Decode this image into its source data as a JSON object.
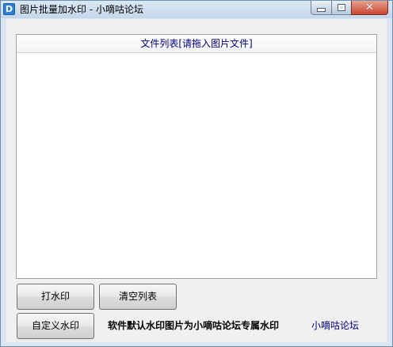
{
  "window": {
    "icon_letter": "D",
    "title": "图片批量加水印 - 小嘀咕论坛",
    "controls": {
      "minimize": "minimize",
      "maximize": "maximize",
      "close": "close"
    }
  },
  "file_list": {
    "header": "文件列表[请拖入图片文件]",
    "items": []
  },
  "buttons": {
    "add_watermark": "打水印",
    "clear_list": "清空列表",
    "custom_watermark": "自定义水印"
  },
  "info_text": "软件默认水印图片为小嘀咕论坛专属水印",
  "forum_link": "小嘀咕论坛",
  "icons": {
    "app": "app-icon",
    "minimize": "minimize-icon",
    "maximize": "maximize-icon",
    "close": "close-icon"
  },
  "colors": {
    "accent_text": "#000080",
    "close_button": "#c7452f",
    "titlebar": "#c4d7ea"
  }
}
